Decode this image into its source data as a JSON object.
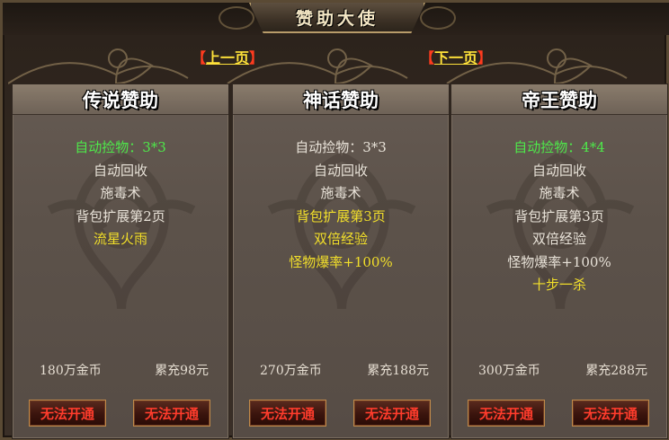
{
  "window": {
    "title": "赞助大使"
  },
  "nav": {
    "prev_label": "上一页",
    "next_label": "下一页",
    "bracket_open": "【",
    "bracket_close": "】"
  },
  "cards": [
    {
      "title": "传说赞助",
      "features": [
        {
          "text": "自动捡物：3*3",
          "color": "green"
        },
        {
          "text": "自动回收",
          "color": "white"
        },
        {
          "text": "施毒术",
          "color": "white"
        },
        {
          "text": "背包扩展第2页",
          "color": "white"
        },
        {
          "text": "流星火雨",
          "color": "yellow"
        }
      ],
      "gold_price": "180万金币",
      "recharge_price": "累充98元",
      "buttons": [
        "无法开通",
        "无法开通"
      ]
    },
    {
      "title": "神话赞助",
      "features": [
        {
          "text": "自动捡物：3*3",
          "color": "white"
        },
        {
          "text": "自动回收",
          "color": "white"
        },
        {
          "text": "施毒术",
          "color": "white"
        },
        {
          "text": "背包扩展第3页",
          "color": "yellow"
        },
        {
          "text": "双倍经验",
          "color": "yellow"
        },
        {
          "text": "怪物爆率+100%",
          "color": "yellow"
        }
      ],
      "gold_price": "270万金币",
      "recharge_price": "累充188元",
      "buttons": [
        "无法开通",
        "无法开通"
      ]
    },
    {
      "title": "帝王赞助",
      "features": [
        {
          "text": "自动捡物：4*4",
          "color": "green"
        },
        {
          "text": "自动回收",
          "color": "white"
        },
        {
          "text": "施毒术",
          "color": "white"
        },
        {
          "text": "背包扩展第3页",
          "color": "white"
        },
        {
          "text": "双倍经验",
          "color": "white"
        },
        {
          "text": "怪物爆率+100%",
          "color": "white"
        },
        {
          "text": "十步一杀",
          "color": "yellow"
        }
      ],
      "gold_price": "300万金币",
      "recharge_price": "累充288元",
      "buttons": [
        "无法开通",
        "无法开通"
      ]
    }
  ],
  "colors": {
    "green_text": "#4ee84a",
    "yellow_text": "#f2df2a",
    "button_text": "#ff3c2c",
    "nav_link": "#ffe23a",
    "nav_bracket": "#ff3b1e"
  }
}
